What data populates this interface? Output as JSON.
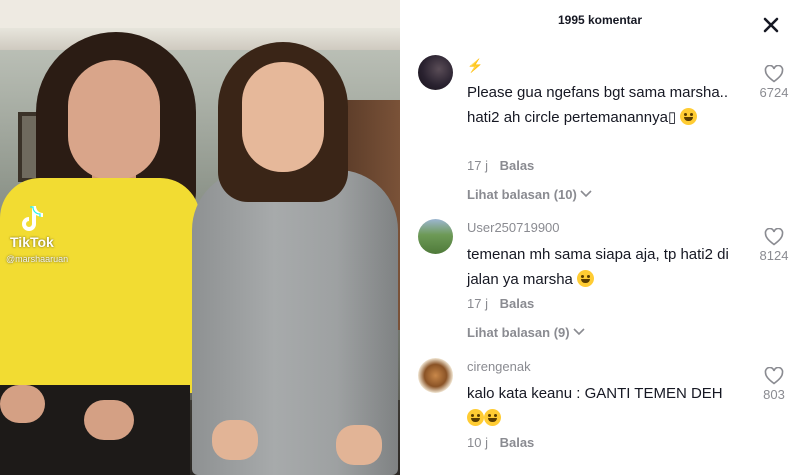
{
  "video": {
    "brand": "TikTok",
    "handle": "@marshaaruan"
  },
  "panel": {
    "title": "1995 komentar",
    "close_icon": "close-icon"
  },
  "comments": [
    {
      "username": "⚡",
      "text": "Please gua ngefans bgt sama marsha.. hati2 ah circle pertemanannya▯",
      "emoji": "crying-face",
      "time": "17 j",
      "reply_label": "Balas",
      "view_replies": "Lihat balasan (10)",
      "likes": "6724"
    },
    {
      "username": "User250719900",
      "text": "temenan mh sama siapa aja, tp hati2 di jalan ya marsha",
      "emoji": "grinning-sweat-face",
      "time": "17 j",
      "reply_label": "Balas",
      "view_replies": "Lihat balasan (9)",
      "likes": "8124"
    },
    {
      "username": "cirengenak",
      "text": "kalo kata keanu : GANTI TEMEN DEH",
      "emoji": "grinning-sweat-face x2",
      "time": "10 j",
      "reply_label": "Balas",
      "likes": "803"
    }
  ],
  "colors": {
    "text_primary": "#161823",
    "text_secondary": "#8a8b91",
    "shirt_yellow": "#f2dc32"
  }
}
